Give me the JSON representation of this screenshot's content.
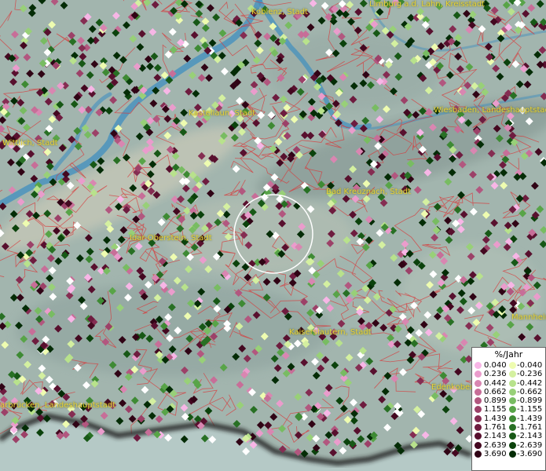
{
  "map": {
    "cities": [
      {
        "name": "Koblenz, Stadt"
      },
      {
        "name": "Limburg a.d. Lahn, Kreisstadt"
      },
      {
        "name": "Kastellaun, Stadt"
      },
      {
        "name": "Wiesbaden, Landeshauptstadt"
      },
      {
        "name": "Wittlich, Stadt"
      },
      {
        "name": "Bad Kreuznach, Stadt"
      },
      {
        "name": "Idar-Oberstein, Stadt"
      },
      {
        "name": "Kaiserslautern, Stadt"
      },
      {
        "name": "Mannheim"
      },
      {
        "name": "Edenkoben"
      },
      {
        "name": "arbrücken, Landeshauptstadt"
      }
    ]
  },
  "legend": {
    "title": "%/Jahr",
    "positive": [
      {
        "value": "0.040",
        "color": "#f7b6e6"
      },
      {
        "value": "0.236",
        "color": "#ea9ccc"
      },
      {
        "value": "0.442",
        "color": "#d986b1"
      },
      {
        "value": "0.662",
        "color": "#c76e98"
      },
      {
        "value": "0.899",
        "color": "#b2577f"
      },
      {
        "value": "1.155",
        "color": "#9c4168"
      },
      {
        "value": "1.439",
        "color": "#852d52"
      },
      {
        "value": "1.761",
        "color": "#6e1c3f"
      },
      {
        "value": "2.143",
        "color": "#58102e"
      },
      {
        "value": "2.639",
        "color": "#440820"
      },
      {
        "value": "3.690",
        "color": "#300415"
      }
    ],
    "negative": [
      {
        "value": "-0.040",
        "color": "#eefcb0"
      },
      {
        "value": "-0.236",
        "color": "#d4f0a0"
      },
      {
        "value": "-0.442",
        "color": "#b8e28c"
      },
      {
        "value": "-0.662",
        "color": "#98d078"
      },
      {
        "value": "-0.899",
        "color": "#78bc62"
      },
      {
        "value": "-1.155",
        "color": "#58a448"
      },
      {
        "value": "-1.439",
        "color": "#3e8a34"
      },
      {
        "value": "-1.761",
        "color": "#287024"
      },
      {
        "value": "-2.143",
        "color": "#175816"
      },
      {
        "value": "-2.639",
        "color": "#0b420c"
      },
      {
        "value": "-3.690",
        "color": "#042c06"
      }
    ]
  }
}
